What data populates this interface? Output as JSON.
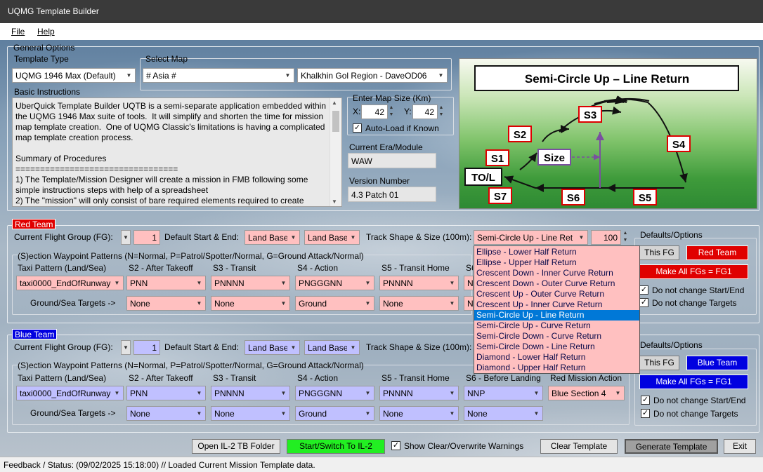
{
  "window": {
    "title": "UQMG Template Builder"
  },
  "menu": {
    "file": "File",
    "help": "Help"
  },
  "general": {
    "group_label": "General Options",
    "template_type_label": "Template Type",
    "template_type": "UQMG 1946 Max (Default)",
    "select_map_label": "Select Map",
    "map": "# Asia #",
    "region": "Khalkhin Gol Region - DaveOD06",
    "basic_instructions_label": "Basic Instructions",
    "instructions": "UberQuick Template Builder UQTB is a semi-separate application embedded within the UQMG 1946 Max suite of tools.  It will simplify and shorten the time for mission map template creation.  One of UQMG Classic's limitations is having a complicated map template creation process.\n\nSummary of Procedures\n=================================\n1) The Template/Mission Designer will create a mission in FMB following some simple instructions steps with help of a spreadsheet\n2) The \"mission\" will only consist of bare required elements required to create",
    "map_size_label": "Enter Map Size (Km)",
    "x_label": "X:",
    "x_value": "42",
    "y_label": "Y:",
    "y_value": "42",
    "autoload_label": "Auto-Load if Known",
    "autoload_checked": true,
    "era_label": "Current Era/Module",
    "era_value": "WAW",
    "version_label": "Version Number",
    "version_value": "4.3 Patch 01"
  },
  "preview": {
    "title": "Semi-Circle Up – Line Return",
    "labels": {
      "to_l": "TO/L",
      "s1": "S1",
      "s2": "S2",
      "s3": "S3",
      "s4": "S4",
      "s5": "S5",
      "s6": "S6",
      "s7": "S7",
      "size": "Size"
    }
  },
  "red": {
    "team_label": "Red Team",
    "fg_label": "Current Flight Group (FG):",
    "fg_value": "1",
    "start_end_label": "Default Start & End:",
    "start": "Land Base",
    "end": "Land Base",
    "track_label": "Track Shape & Size (100m):",
    "track_shape": "Semi-Circle Up - Line Ret",
    "track_size": "100",
    "patterns_label": "(S)ection Waypoint Patterns (N=Normal, P=Patrol/Spotter/Normal, G=Ground Attack/Normal)",
    "col_headers": [
      "Taxi Pattern (Land/Sea)",
      "S2 - After Takeoff",
      "S3 - Transit",
      "S4 - Action",
      "S5 - Transit Home",
      "S6 - Before Landing"
    ],
    "taxi": "taxi0000_EndOfRunway",
    "s2": "PNN",
    "s3": "PNNNN",
    "s4": "PNGGGNN",
    "s5": "PNNNN",
    "s6": "NNP",
    "targets_label": "Ground/Sea Targets ->",
    "t2": "None",
    "t3": "None",
    "t4": "Ground",
    "t5": "None",
    "t6": "None",
    "defaults_label": "Defaults/Options",
    "this_fg": "This FG",
    "team_btn": "Red Team",
    "make_all": "Make All FGs = FG1",
    "no_start_end": "Do not change Start/End",
    "no_targets": "Do not change Targets"
  },
  "track_options": [
    "Ellipse - Lower Half Return",
    "Ellipse - Upper Half Return",
    "Crescent Down - Inner Curve Return",
    "Crescent Down - Outer Curve Return",
    "Crescent Up - Outer Curve Return",
    "Crescent Up -  Inner Curve Return",
    "Semi-Circle Up - Line Return",
    "Semi-Circle Up - Curve Return",
    "Semi-Circle Down - Curve Return",
    "Semi-Circle Down - Line Return",
    "Diamond - Lower Half Return",
    "Diamond - Upper Half Return"
  ],
  "track_selected_index": 6,
  "blue": {
    "team_label": "Blue Team",
    "fg_label": "Current Flight Group (FG):",
    "fg_value": "1",
    "start_end_label": "Default Start & End:",
    "start": "Land Base",
    "end": "Land Base",
    "track_label": "Track Shape & Size (100m):",
    "patterns_label": "(S)ection Waypoint Patterns (N=Normal, P=Patrol/Spotter/Normal, G=Ground Attack/Normal)",
    "col_headers": [
      "Taxi Pattern (Land/Sea)",
      "S2 - After Takeoff",
      "S3 - Transit",
      "S4 - Action",
      "S5 - Transit Home",
      "S6 - Before Landing",
      "Red Mission Action"
    ],
    "taxi": "taxi0000_EndOfRunway",
    "s2": "PNN",
    "s3": "PNNNN",
    "s4": "PNGGGNN",
    "s5": "PNNNN",
    "s6": "NNP",
    "red_action": "Blue Section 4",
    "targets_label": "Ground/Sea Targets ->",
    "t2": "None",
    "t3": "None",
    "t4": "Ground",
    "t5": "None",
    "t6": "None",
    "defaults_label": "Defaults/Options",
    "this_fg": "This FG",
    "team_btn": "Blue Team",
    "make_all": "Make All FGs = FG1",
    "no_start_end": "Do not change Start/End",
    "no_targets": "Do not change Targets"
  },
  "bottom": {
    "open_folder": "Open IL-2 TB Folder",
    "start_switch": "Start/Switch To IL-2",
    "show_warnings": "Show Clear/Overwrite Warnings",
    "clear_template": "Clear Template",
    "generate": "Generate Template",
    "exit": "Exit"
  },
  "status": {
    "label": "Feedback / Status:",
    "text": "(09/02/2025 15:18:00) // Loaded Current Mission Template data."
  },
  "colors": {
    "red_field": "#ffc0c0",
    "blue_field": "#c0c0ff",
    "red_badge": "#e00000",
    "blue_badge": "#0000e0",
    "start_button": "#22ee22"
  }
}
